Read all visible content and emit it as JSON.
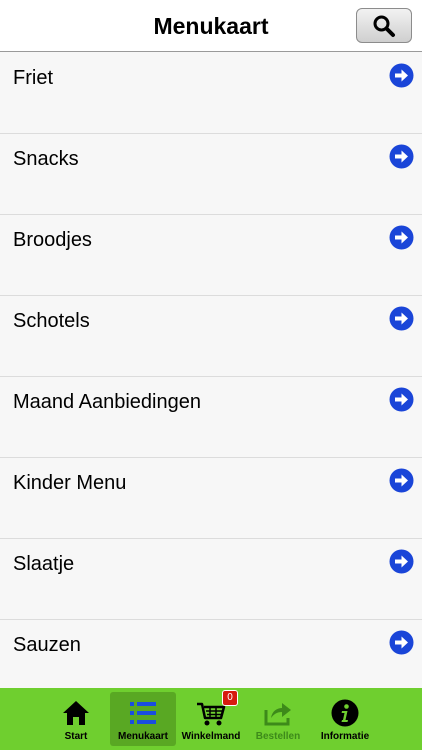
{
  "header": {
    "title": "Menukaart",
    "search_icon": "search-icon"
  },
  "menu": {
    "items": [
      {
        "label": "Friet",
        "icon": "arrow-right-circle-icon"
      },
      {
        "label": "Snacks",
        "icon": "arrow-right-circle-icon"
      },
      {
        "label": "Broodjes",
        "icon": "arrow-right-circle-icon"
      },
      {
        "label": "Schotels",
        "icon": "arrow-right-circle-icon"
      },
      {
        "label": "Maand Aanbiedingen",
        "icon": "arrow-right-circle-icon"
      },
      {
        "label": "Kinder Menu",
        "icon": "arrow-right-circle-icon"
      },
      {
        "label": "Slaatje",
        "icon": "arrow-right-circle-icon"
      },
      {
        "label": "Sauzen",
        "icon": "arrow-right-circle-icon"
      }
    ]
  },
  "tabbar": {
    "tabs": [
      {
        "label": "Start",
        "icon": "home-icon"
      },
      {
        "label": "Menukaart",
        "icon": "list-icon"
      },
      {
        "label": "Winkelmand",
        "icon": "cart-icon"
      },
      {
        "label": "Bestellen",
        "icon": "share-icon"
      },
      {
        "label": "Informatie",
        "icon": "info-icon"
      }
    ],
    "cart_count": "0"
  },
  "colors": {
    "tabbar_bg": "#6fcf2f",
    "tab_active_bg": "#59a823",
    "arrow_blue": "#1a45d8",
    "badge_red": "#d61b0f",
    "list_icon_blue": "#1a4ee0"
  }
}
